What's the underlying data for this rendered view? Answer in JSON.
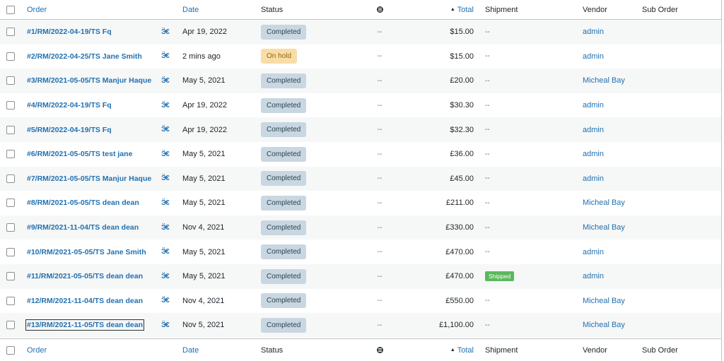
{
  "columns": {
    "order": "Order",
    "date": "Date",
    "status": "Status",
    "total": "Total",
    "shipment": "Shipment",
    "vendor": "Vendor",
    "sub_order": "Sub Order"
  },
  "sort": {
    "column": "total",
    "direction": "ascending"
  },
  "rows": [
    {
      "order": "#1/RM/2022-04-19/TS Fq",
      "date": "Apr 19, 2022",
      "status": "Completed",
      "ext": "--",
      "total": "$15.00",
      "shipment": "--",
      "vendor": "admin",
      "sub_order": ""
    },
    {
      "order": "#2/RM/2022-04-25/TS Jane Smith",
      "date": "2 mins ago",
      "status": "On hold",
      "ext": "--",
      "total": "$15.00",
      "shipment": "--",
      "vendor": "admin",
      "sub_order": ""
    },
    {
      "order": "#3/RM/2021-05-05/TS Manjur Haque",
      "date": "May 5, 2021",
      "status": "Completed",
      "ext": "--",
      "total": "£20.00",
      "shipment": "--",
      "vendor": "Micheal Bay",
      "sub_order": ""
    },
    {
      "order": "#4/RM/2022-04-19/TS Fq",
      "date": "Apr 19, 2022",
      "status": "Completed",
      "ext": "--",
      "total": "$30.30",
      "shipment": "--",
      "vendor": "admin",
      "sub_order": ""
    },
    {
      "order": "#5/RM/2022-04-19/TS Fq",
      "date": "Apr 19, 2022",
      "status": "Completed",
      "ext": "--",
      "total": "$32.30",
      "shipment": "--",
      "vendor": "admin",
      "sub_order": ""
    },
    {
      "order": "#6/RM/2021-05-05/TS test jane",
      "date": "May 5, 2021",
      "status": "Completed",
      "ext": "--",
      "total": "£36.00",
      "shipment": "--",
      "vendor": "admin",
      "sub_order": ""
    },
    {
      "order": "#7/RM/2021-05-05/TS Manjur Haque",
      "date": "May 5, 2021",
      "status": "Completed",
      "ext": "--",
      "total": "£45.00",
      "shipment": "--",
      "vendor": "admin",
      "sub_order": ""
    },
    {
      "order": "#8/RM/2021-05-05/TS dean dean",
      "date": "May 5, 2021",
      "status": "Completed",
      "ext": "--",
      "total": "£211.00",
      "shipment": "--",
      "vendor": "Micheal Bay",
      "sub_order": ""
    },
    {
      "order": "#9/RM/2021-11-04/TS dean dean",
      "date": "Nov 4, 2021",
      "status": "Completed",
      "ext": "--",
      "total": "£330.00",
      "shipment": "--",
      "vendor": "Micheal Bay",
      "sub_order": ""
    },
    {
      "order": "#10/RM/2021-05-05/TS Jane Smith",
      "date": "May 5, 2021",
      "status": "Completed",
      "ext": "--",
      "total": "£470.00",
      "shipment": "--",
      "vendor": "admin",
      "sub_order": ""
    },
    {
      "order": "#11/RM/2021-05-05/TS dean dean",
      "date": "May 5, 2021",
      "status": "Completed",
      "ext": "--",
      "total": "£470.00",
      "shipment": "Shipped",
      "vendor": "admin",
      "sub_order": ""
    },
    {
      "order": "#12/RM/2021-11-04/TS dean dean",
      "date": "Nov 4, 2021",
      "status": "Completed",
      "ext": "--",
      "total": "£550.00",
      "shipment": "--",
      "vendor": "Micheal Bay",
      "sub_order": ""
    },
    {
      "order": "#13/RM/2021-11-05/TS dean dean",
      "date": "Nov 5, 2021",
      "status": "Completed",
      "ext": "--",
      "total": "£1,100.00",
      "shipment": "--",
      "vendor": "Micheal Bay",
      "sub_order": ""
    }
  ],
  "icons": {
    "invoice": "invoice-icon",
    "ext": "circle-menu-icon",
    "sort": "sort-up-arrow-icon"
  },
  "colors": {
    "link": "#2271b1",
    "completed_bg": "#c8d7e1",
    "onhold_bg": "#f8dda7",
    "shipped_bg": "#5cb85c"
  }
}
